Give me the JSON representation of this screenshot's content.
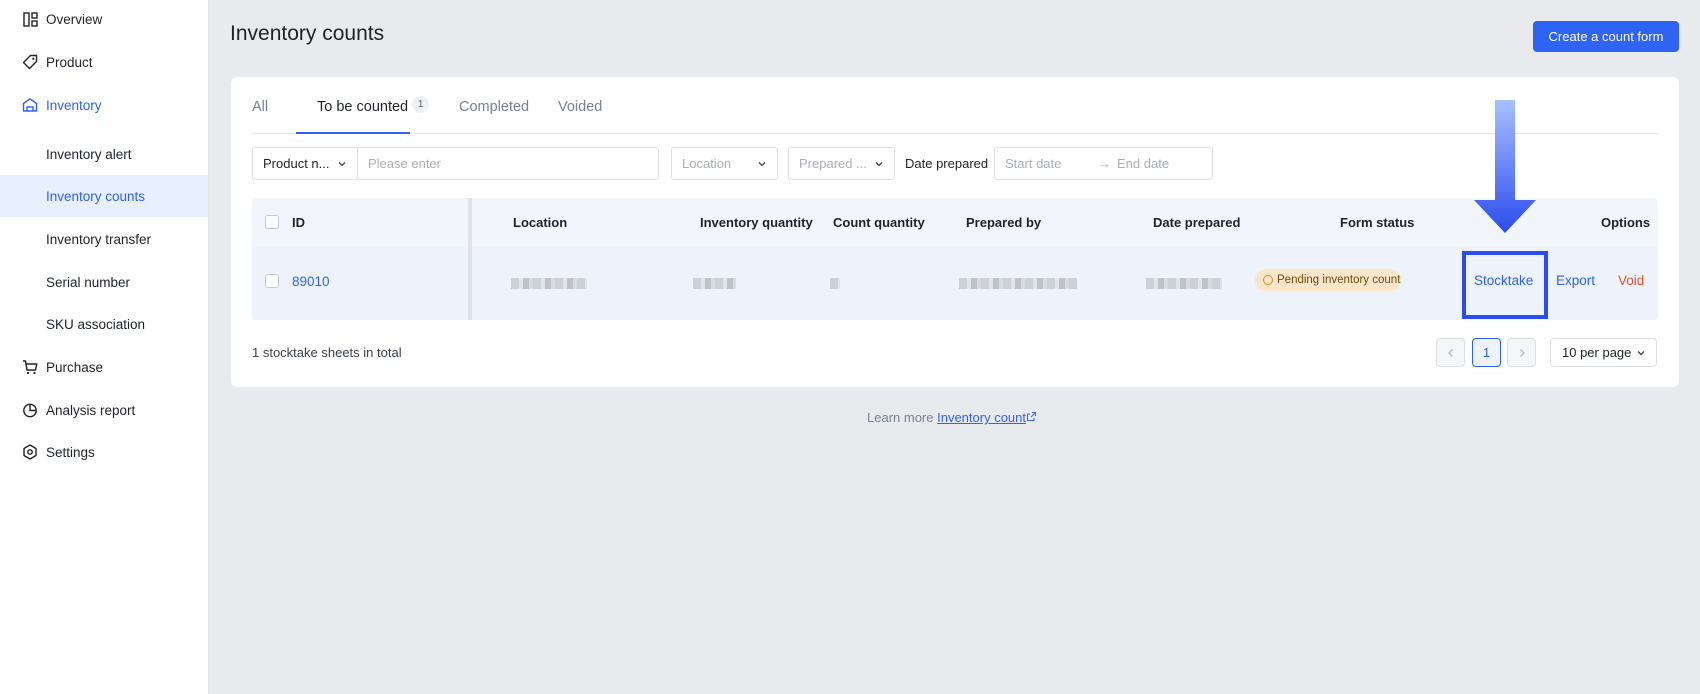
{
  "sidebar": {
    "items": [
      {
        "label": "Overview",
        "icon": "overview-icon"
      },
      {
        "label": "Product",
        "icon": "tag-icon"
      },
      {
        "label": "Inventory",
        "icon": "warehouse-icon"
      },
      {
        "label": "Inventory alert"
      },
      {
        "label": "Inventory counts"
      },
      {
        "label": "Inventory transfer"
      },
      {
        "label": "Serial number"
      },
      {
        "label": "SKU association"
      },
      {
        "label": "Purchase",
        "icon": "cart-icon"
      },
      {
        "label": "Analysis report",
        "icon": "pie-chart-icon"
      },
      {
        "label": "Settings",
        "icon": "gear-icon"
      }
    ],
    "active_item": "Inventory counts"
  },
  "header": {
    "title": "Inventory counts",
    "create_button": "Create a count form"
  },
  "tabs": [
    {
      "label": "All"
    },
    {
      "label": "To be counted",
      "badge": "1"
    },
    {
      "label": "Completed"
    },
    {
      "label": "Voided"
    }
  ],
  "filters": {
    "product_select": "Product n...",
    "search_placeholder": "Please enter",
    "location_placeholder": "Location",
    "prepared_placeholder": "Prepared ...",
    "date_label": "Date prepared",
    "start_date_placeholder": "Start date",
    "end_date_placeholder": "End date",
    "date_separator": "→"
  },
  "table": {
    "columns": [
      "ID",
      "Location",
      "Inventory quantity",
      "Count quantity",
      "Prepared by",
      "Date prepared",
      "Form status",
      "Options"
    ],
    "rows": [
      {
        "id": "89010",
        "status": "Pending inventory count",
        "actions": [
          "Stocktake",
          "Export",
          "Void"
        ]
      }
    ]
  },
  "footer": {
    "total_text": "1 stocktake sheets in total",
    "current_page": "1",
    "per_page": "10 per page"
  },
  "learn_more": {
    "prefix": "Learn more",
    "link": "Inventory count"
  },
  "colors": {
    "accent": "#2f63f3",
    "danger": "#ee4d2d",
    "annotation": "#2b4cf0",
    "pending_pill": "#fbe6c9"
  }
}
